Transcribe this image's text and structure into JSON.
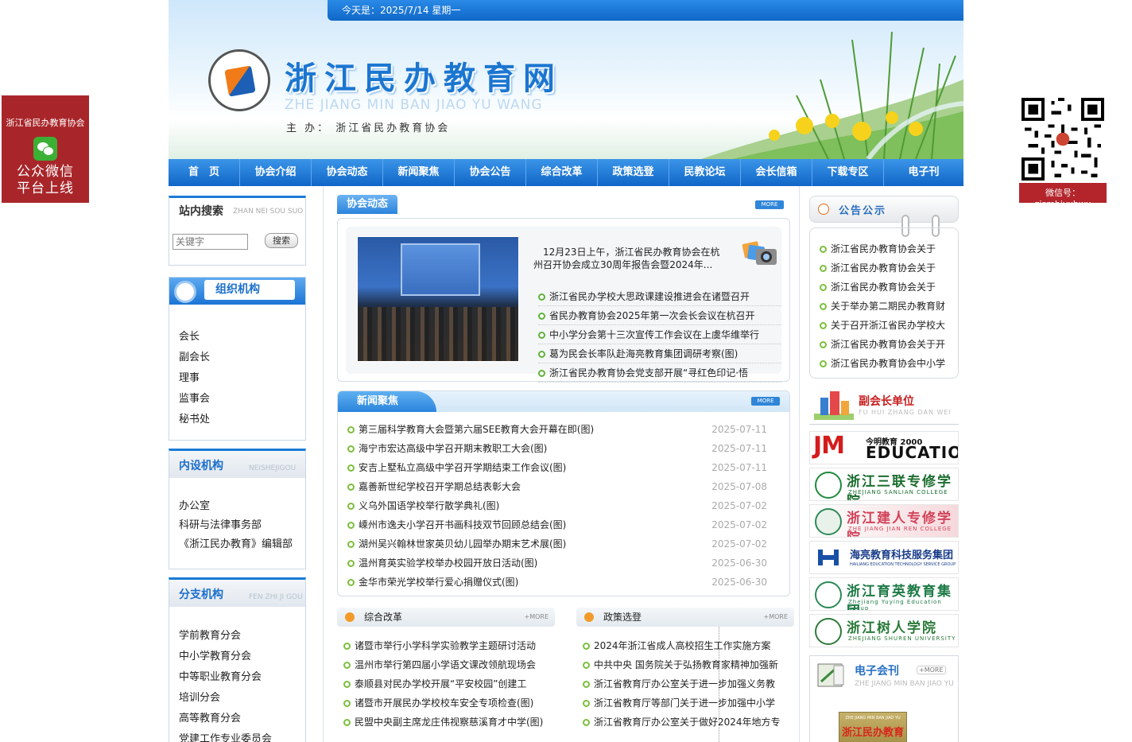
{
  "float_left": {
    "title": "浙江省民办教育协会",
    "slogan_line1": "公众微信",
    "slogan_line2": "平台上线"
  },
  "float_right": {
    "caption": "微信号：zjsmbjyxhwx"
  },
  "header": {
    "date_text": "今天是：2025/7/14 星期一",
    "site_title": "浙江民办教育网",
    "site_pinyin": "ZHE JIANG  MIN BAN JIAO YU WANG",
    "sponsor": "主 办： 浙江省民办教育协会"
  },
  "nav": [
    "首　页",
    "协会介绍",
    "协会动态",
    "新闻聚焦",
    "协会公告",
    "综合改革",
    "政策选登",
    "民教论坛",
    "会长信箱",
    "下载专区",
    "电子刊"
  ],
  "search": {
    "title": "站内搜索",
    "title_en": "ZHAN NEI SOU SUO",
    "placeholder": "关键字",
    "button": "搜索"
  },
  "org": {
    "title": "组织机构",
    "items": [
      "会长",
      "副会长",
      "理事",
      "监事会",
      "秘书处"
    ]
  },
  "neishe": {
    "title": "内设机构",
    "title_en": "NEISHEJIGOU",
    "items": [
      "办公室",
      "科研与法律事务部",
      "《浙江民办教育》编辑部"
    ]
  },
  "fenzhi": {
    "title": "分支机构",
    "title_en": "FEN ZHI JI GOU",
    "items": [
      "学前教育分会",
      "中小学教育分会",
      "中等职业教育分会",
      "培训分会",
      "高等教育分会",
      "党建工作专业委员会"
    ]
  },
  "dongtai": {
    "title": "协会动态",
    "more": "MORE",
    "headline": "12月23日上午，浙江省民办教育协会在杭州召开协会成立30周年报告会暨2024年...",
    "items": [
      "浙江省民办学校大思政课建设推进会在诸暨召开",
      "省民办教育协会2025年第一次会长会议在杭召开",
      "中小学分会第十三次宣传工作会议在上虞华维举行",
      "葛为民会长率队赴海亮教育集团调研考察(图)",
      "浙江省民办教育协会党支部开展“寻红色印记·悟"
    ]
  },
  "news": {
    "title": "新闻聚焦",
    "more": "MORE",
    "items": [
      {
        "title": "第三届科学教育大会暨第六届SEE教育大会开幕在即(图)",
        "date": "2025-07-11"
      },
      {
        "title": "海宁市宏达高级中学召开期末教职工大会(图)",
        "date": "2025-07-11"
      },
      {
        "title": "安吉上墅私立高级中学召开学期结束工作会议(图)",
        "date": "2025-07-11"
      },
      {
        "title": "嘉善新世纪学校召开学期总结表彰大会",
        "date": "2025-07-08"
      },
      {
        "title": "义乌外国语学校举行散学典礼(图)",
        "date": "2025-07-02"
      },
      {
        "title": "嵊州市逸夫小学召开书画科技双节回顾总结会(图)",
        "date": "2025-07-02"
      },
      {
        "title": "湖州吴兴翰林世家英贝幼儿园举办期末艺术展(图)",
        "date": "2025-07-02"
      },
      {
        "title": "温州育英实验学校举办校园开放日活动(图)",
        "date": "2025-06-30"
      },
      {
        "title": "金华市荣光学校举行爱心捐赠仪式(图)",
        "date": "2025-06-30"
      }
    ]
  },
  "reform": {
    "title": "综合改革",
    "more": "+MORE",
    "items": [
      "诸暨市举行小学科学实验教学主题研讨活动",
      "温州市举行第四届小学语文课改领航现场会",
      "泰顺县对民办学校开展“平安校园”创建工",
      "诸暨市开展民办学校校车安全专项检查(图)",
      "民盟中央副主席龙庄伟视察慈溪育才中学(图)"
    ]
  },
  "policy": {
    "title": "政策选登",
    "more": "+MORE",
    "items": [
      "2024年浙江省成人高校招生工作实施方案",
      "中共中央 国务院关于弘扬教育家精神加强新",
      "浙江省教育厅办公室关于进一步加强义务教",
      "浙江省教育厅等部门关于进一步加强中小学",
      "浙江省教育厅办公室关于做好2024年地方专"
    ]
  },
  "notice": {
    "title": "公告公示",
    "items": [
      "浙江省民办教育协会关于",
      "浙江省民办教育协会关于",
      "浙江省民办教育协会关于",
      "关于举办第二期民办教育财",
      "关于召开浙江省民办学校大",
      "浙江省民办教育协会关于开",
      "浙江省民办教育协会中小学"
    ]
  },
  "vp_units": {
    "title": "副会长单位",
    "title_en": "FU HUI ZHANG DAN WEI",
    "jm": {
      "mark": "JM",
      "sub": "今明教育 2000",
      "edu": "EDUCATION"
    },
    "sanlian": {
      "name": "浙江三联专修学院",
      "sub": "ZHEJIANG SANLIAN COLLEGE"
    },
    "jianren": {
      "name": "浙江建人专修学院",
      "sub": "ZHE JIANG JIAN REN COLLEGE"
    },
    "hailiang": {
      "name": "海亮教育科技服务集团",
      "sub": "HAILIANG EDUCATION TECHNOLOGY SERVICE GROUP"
    },
    "yuying": {
      "name": "浙江育英教育集团",
      "sub": "Zhejiang Yuying Education Group"
    },
    "shuren": {
      "name": "浙江树人学院",
      "sub": "ZHEJIANG SHUREN UNIVERSITY"
    }
  },
  "ekan": {
    "title": "电子会刊",
    "more": "+MORE",
    "title_en": "ZHE JIANG MIN BAN JIAO YU",
    "cover_en": "ZHE JIANG MIN BAN JIAO YU",
    "cover_title": "浙江民办教育"
  }
}
